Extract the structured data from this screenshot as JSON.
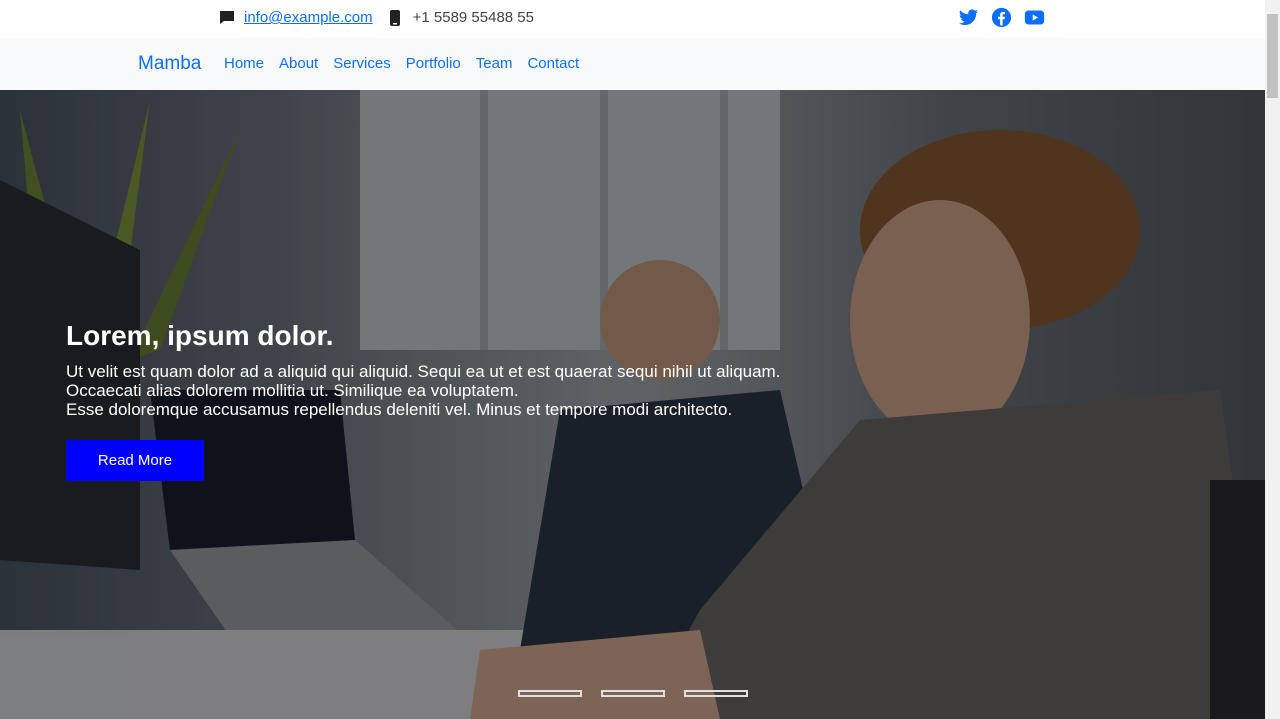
{
  "topbar": {
    "email": "info@example.com",
    "phone": "+1 5589 55488 55",
    "icons": [
      "chat-icon",
      "phone-icon"
    ],
    "social": [
      "twitter-icon",
      "facebook-icon",
      "youtube-icon"
    ]
  },
  "navbar": {
    "brand": "Mamba",
    "items": [
      "Home",
      "About",
      "Services",
      "Portfolio",
      "Team",
      "Contact"
    ]
  },
  "hero": {
    "title": "Lorem, ipsum dolor.",
    "lines": [
      "Ut velit est quam dolor ad a aliquid qui aliquid. Sequi ea ut et est quaerat sequi nihil ut aliquam.",
      "Occaecati alias dolorem mollitia ut. Similique ea voluptatem.",
      "Esse doloremque accusamus repellendus deleniti vel. Minus et tempore modi architecto."
    ],
    "button": "Read More",
    "slide_count": 3
  },
  "colors": {
    "link": "#0d6efd",
    "button": "#0000ff",
    "navbar_bg": "#f8f9fa"
  }
}
